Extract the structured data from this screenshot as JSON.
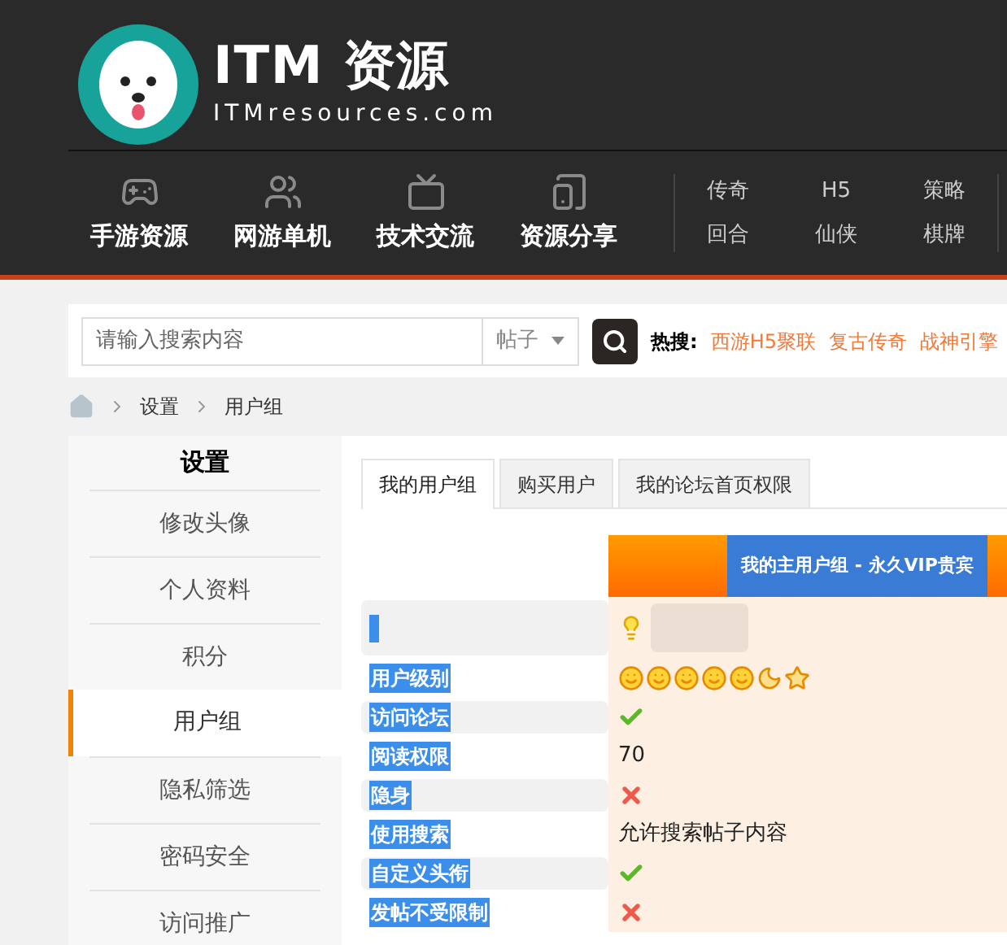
{
  "header": {
    "logo_title": "ITM 资源",
    "logo_subtitle": "ITMresources.com",
    "nav": [
      {
        "label": "手游资源"
      },
      {
        "label": "网游单机"
      },
      {
        "label": "技术交流"
      },
      {
        "label": "资源分享"
      }
    ],
    "links": [
      "传奇",
      "H5",
      "策略",
      "回合",
      "仙侠",
      "棋牌"
    ]
  },
  "search": {
    "placeholder": "请输入搜索内容",
    "scope": "帖子",
    "hot_label": "热搜:",
    "hot": [
      "西游H5聚联",
      "复古传奇",
      "战神引擎"
    ]
  },
  "breadcrumb": [
    "设置",
    "用户组"
  ],
  "sidebar": {
    "title": "设置",
    "items": [
      {
        "label": "修改头像",
        "selected": false
      },
      {
        "label": "个人资料",
        "selected": false
      },
      {
        "label": "积分",
        "selected": false
      },
      {
        "label": "用户组",
        "selected": true
      },
      {
        "label": "隐私筛选",
        "selected": false
      },
      {
        "label": "密码安全",
        "selected": false
      },
      {
        "label": "访问推广",
        "selected": false
      }
    ]
  },
  "tabs": [
    {
      "label": "我的用户组",
      "selected": true
    },
    {
      "label": "购买用户",
      "selected": false
    },
    {
      "label": "我的论坛首页权限",
      "selected": false
    }
  ],
  "table": {
    "header": "我的主用户组 - 永久VIP贵宾",
    "rows": [
      {
        "kind": "blurred"
      },
      {
        "label": "用户级别",
        "kind": "rank"
      },
      {
        "label": "访问论坛",
        "kind": "check"
      },
      {
        "label": "阅读权限",
        "kind": "text",
        "value": "70"
      },
      {
        "label": "隐身",
        "kind": "cross"
      },
      {
        "label": "使用搜索",
        "kind": "text",
        "value": "允许搜索帖子内容"
      },
      {
        "label": "自定义头衔",
        "kind": "check"
      },
      {
        "label": "发帖不受限制",
        "kind": "cross"
      }
    ]
  }
}
